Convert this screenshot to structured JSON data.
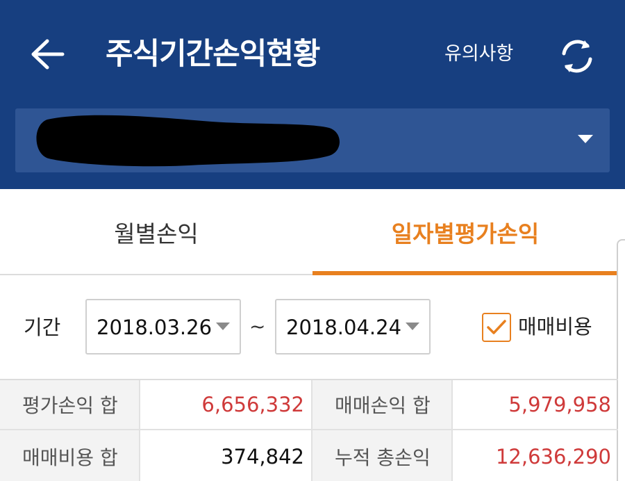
{
  "header": {
    "title": "주식기간손익현황",
    "notice_label": "유의사항",
    "icons": {
      "back": "arrow-left-icon",
      "refresh": "refresh-icon"
    }
  },
  "account": {
    "value": ""
  },
  "tabs": [
    {
      "label": "월별손익",
      "active": false
    },
    {
      "label": "일자별평가손익",
      "active": true
    }
  ],
  "filter": {
    "period_label": "기간",
    "from_date": "2018.03.26",
    "separator": "~",
    "to_date": "2018.04.24",
    "fee_label": "매매비용",
    "fee_checked": true
  },
  "summary": [
    [
      {
        "label": "평가손익 합",
        "value": "6,656,332",
        "color": "#cf3a3a"
      },
      {
        "label": "매매손익 합",
        "value": "5,979,958",
        "color": "#cf3a3a"
      }
    ],
    [
      {
        "label": "매매비용 합",
        "value": "374,842",
        "color": "#111111"
      },
      {
        "label": "누적 총손익",
        "value": "12,636,290",
        "color": "#cf3a3a"
      }
    ]
  ],
  "colors": {
    "header_bg": "#173f80",
    "select_bg": "#2f5594",
    "accent": "#e8801f",
    "positive": "#cf3a3a"
  }
}
